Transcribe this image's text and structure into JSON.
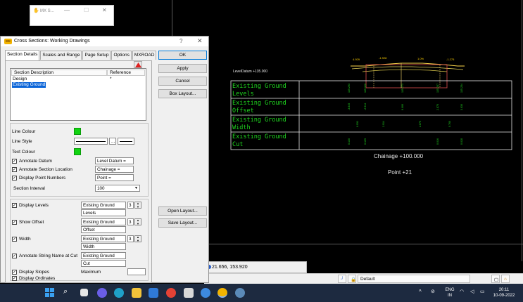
{
  "cad": {
    "small_window_title": "MX S...",
    "level_datum": "LevelDatum +135.000",
    "rows": [
      {
        "line1": "Existing Ground",
        "line2": "Levels"
      },
      {
        "line1": "Existing Ground",
        "line2": "Offset"
      },
      {
        "line1": "Existing Ground",
        "line2": "Width"
      },
      {
        "line1": "Existing Ground",
        "line2": "Cut"
      }
    ],
    "chainage": "Chainage +100.000",
    "point": "Point +21"
  },
  "dialog": {
    "title": "Cross Sections: Working Drawings",
    "help_glyph": "?",
    "close_glyph": "✕",
    "tabs": [
      "Section Details",
      "Scales and Range",
      "Page Setup",
      "Options",
      "MXROAD"
    ],
    "list_headers": {
      "description": "Section Description",
      "reference": "Reference"
    },
    "list_rows": [
      {
        "description": "Design",
        "reference": "*"
      },
      {
        "description": "Existing Ground",
        "reference": ""
      }
    ],
    "line_colour_label": "Line Colour",
    "line_style_label": "Line Style",
    "text_colour_label": "Text Colour",
    "browse_label": "...",
    "annotate_datum": {
      "label": "Annotate Datum",
      "value": "Level Datum ="
    },
    "annotate_section_location": {
      "label": "Annotate Section Location",
      "value": "Chainage ="
    },
    "display_point_numbers": {
      "label": "Display Point Numbers",
      "value": "Point ="
    },
    "section_interval": {
      "label": "Section Interval",
      "value": "100"
    },
    "display_levels": {
      "label": "Display Levels",
      "string": "Existing Ground",
      "decimals": "3",
      "title": "Levels"
    },
    "show_offset": {
      "label": "Show Offset",
      "string": "Existing Ground",
      "decimals": "3",
      "title": "Offset"
    },
    "width": {
      "label": "Width",
      "string": "Existing Ground",
      "decimals": "3",
      "title": "Width"
    },
    "annotate_string_name": {
      "label": "Annotate String Name at Cut",
      "string": "Existing Ground",
      "title": "Cut"
    },
    "display_slopes": {
      "label": "Display Slopes",
      "maximum_label": "Maximum",
      "maximum_value": ""
    },
    "display_ordinates": {
      "label": "Display Ordinates"
    },
    "buttons": {
      "ok": "OK",
      "apply": "Apply",
      "cancel": "Cancel",
      "box_layout": "Box Layout...",
      "open_layout": "Open Layout...",
      "save_layout": "Save Layout..."
    }
  },
  "status": {
    "coords": "21.656, 153.920",
    "layer": "Default"
  },
  "taskbar": {
    "lang_top": "ENG",
    "lang_bottom": "IN",
    "time": "20:11",
    "date": "10-09-2022"
  }
}
